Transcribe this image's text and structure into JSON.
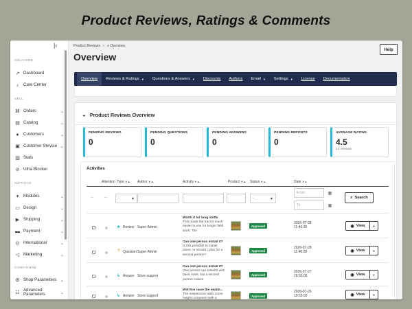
{
  "banner": "Product Reviews, Ratings & Comments",
  "sidebar": {
    "sections": [
      {
        "title": "WELCOME",
        "items": [
          {
            "label": "Dashboard",
            "icon": "trending-up-icon",
            "chevron": false
          },
          {
            "label": "Care Center",
            "icon": "bell-icon",
            "chevron": false
          }
        ]
      },
      {
        "title": "SELL",
        "items": [
          {
            "label": "Orders",
            "icon": "cart-icon",
            "chevron": true
          },
          {
            "label": "Catalog",
            "icon": "store-icon",
            "chevron": true
          },
          {
            "label": "Customers",
            "icon": "user-icon",
            "chevron": true
          },
          {
            "label": "Customer Service",
            "icon": "chat-icon",
            "chevron": true
          },
          {
            "label": "Stats",
            "icon": "bar-chart-icon",
            "chevron": false
          },
          {
            "label": "Ultra Blocker",
            "icon": "block-icon",
            "chevron": false
          }
        ]
      },
      {
        "title": "IMPROVE",
        "items": [
          {
            "label": "Modules",
            "icon": "puzzle-icon",
            "chevron": true
          },
          {
            "label": "Design",
            "icon": "desktop-icon",
            "chevron": true
          },
          {
            "label": "Shipping",
            "icon": "truck-icon",
            "chevron": true
          },
          {
            "label": "Payment",
            "icon": "card-icon",
            "chevron": true
          },
          {
            "label": "International",
            "icon": "globe-icon",
            "chevron": true
          },
          {
            "label": "Marketing",
            "icon": "megaphone-icon",
            "chevron": true
          }
        ]
      },
      {
        "title": "CONFIGURE",
        "items": [
          {
            "label": "Shop Parameters",
            "icon": "gear-icon",
            "chevron": true
          },
          {
            "label": "Advanced Parameters",
            "icon": "settings-icon",
            "chevron": true
          }
        ]
      }
    ]
  },
  "header": {
    "breadcrumb": [
      "Product Reviews",
      "Overview"
    ],
    "title": "Overview",
    "help_label": "Help"
  },
  "nav": {
    "items": [
      {
        "label": "Overview",
        "dropdown": false,
        "active": true
      },
      {
        "label": "Reviews & Ratings",
        "dropdown": true,
        "active": false
      },
      {
        "label": "Questions & Answers",
        "dropdown": true,
        "active": false
      },
      {
        "label": "Discounts",
        "dropdown": false,
        "active": false
      },
      {
        "label": "Authors",
        "dropdown": false,
        "active": false
      },
      {
        "label": "Email",
        "dropdown": true,
        "active": false
      },
      {
        "label": "Settings",
        "dropdown": true,
        "active": false
      },
      {
        "label": "License",
        "dropdown": false,
        "active": false
      },
      {
        "label": "Documentation",
        "dropdown": false,
        "active": false
      }
    ]
  },
  "overview": {
    "title": "Product Reviews Overview",
    "kpis": [
      {
        "label": "PENDING REVIEWS",
        "value": "0",
        "sub": ""
      },
      {
        "label": "PENDING QUESTIONS",
        "value": "0",
        "sub": ""
      },
      {
        "label": "PENDING ANSWERS",
        "value": "0",
        "sub": ""
      },
      {
        "label": "PENDING REPORTS",
        "value": "0",
        "sub": ""
      },
      {
        "label": "AVERAGE RATING",
        "value": "4.5",
        "sub": "13 reviews"
      }
    ]
  },
  "activities": {
    "title": "Activities",
    "columns": [
      "Attention",
      "Type",
      "Author",
      "Activity",
      "Product",
      "Status",
      "Date"
    ],
    "filters": {
      "attention": "--",
      "col2": "--",
      "type_select": "-",
      "status_select": "-",
      "date_from_placeholder": "From",
      "date_to_placeholder": "To",
      "search_label": "Search"
    },
    "rows": [
      {
        "type": "Review",
        "type_icon": "star-icon",
        "author": "Super Admin",
        "activity_title": "Worth it for long shifts",
        "activity_body": "This made the tractor much easier to use for longer field work. The",
        "status": "Approved",
        "date": "2026-07-28",
        "time": "11:46:28",
        "view_label": "View"
      },
      {
        "type": "Question",
        "type_icon": "question-icon",
        "author": "Super Admin",
        "activity_title": "Can one person install it?",
        "activity_body": "Is this possible to install alone, or should I plan for a second person?",
        "status": "Approved",
        "date": "2026-07-28",
        "time": "11:46:28",
        "view_label": "View"
      },
      {
        "type": "Answer",
        "type_icon": "reply-icon",
        "author": "Store support",
        "activity_title": "Can one person install it?",
        "activity_body": "One person can install it with basic tools, but a second person makes",
        "status": "Approved",
        "date": "2026-07-27",
        "time": "19:55:00",
        "view_label": "View"
      },
      {
        "type": "Answer",
        "type_icon": "reply-icon",
        "author": "Store support",
        "activity_title": "Will this raise the seatin...",
        "activity_body": "The suspension adds some height compared with a",
        "status": "Approved",
        "date": "2026-07-26",
        "time": "19:55:00",
        "view_label": "View"
      }
    ]
  }
}
